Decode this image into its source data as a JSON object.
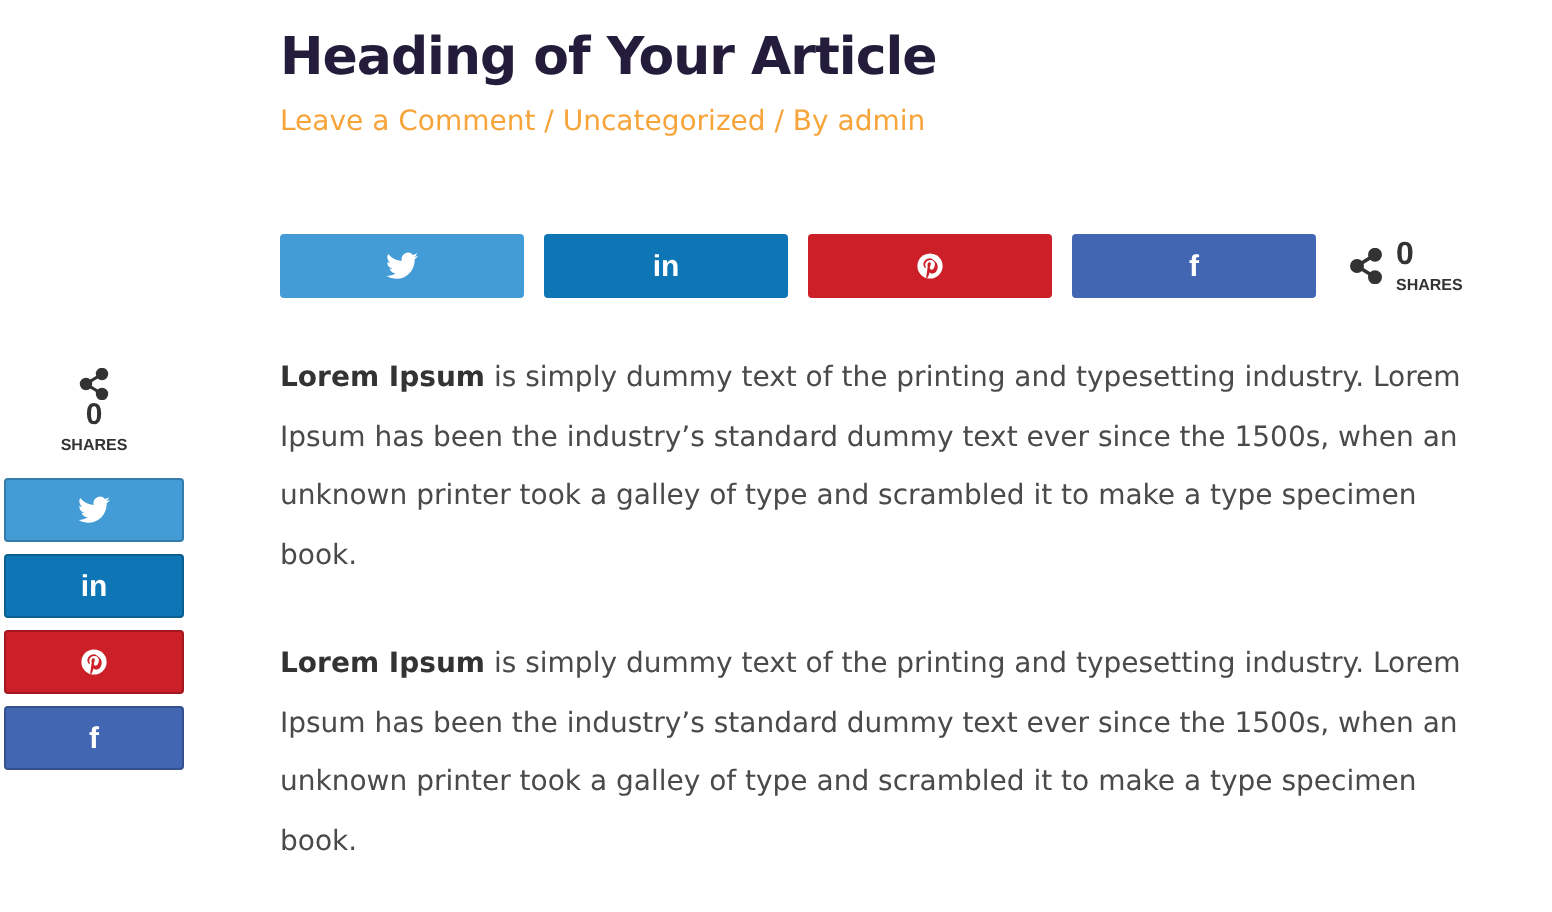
{
  "article": {
    "title": "Heading of Your Article",
    "meta": [
      {
        "text": "Leave a Comment"
      },
      {
        "text": " / "
      },
      {
        "text": "Uncategorized"
      },
      {
        "text": " / By "
      },
      {
        "text": "admin"
      }
    ]
  },
  "share_bar": {
    "buttons": [
      {
        "kind": "twitter",
        "color": "#439cd6"
      },
      {
        "kind": "linkedin",
        "label": "in",
        "color": "#0e76b5"
      },
      {
        "kind": "pinterest",
        "color": "#cc1f28"
      },
      {
        "kind": "facebook",
        "label": "f",
        "color": "#4266b2"
      }
    ],
    "count": "0",
    "count_label": "SHARES"
  },
  "sidebar": {
    "count": "0",
    "count_label": "SHARES",
    "buttons": [
      {
        "kind": "twitter",
        "color": "#439cd6"
      },
      {
        "kind": "linkedin",
        "label": "in",
        "color": "#0e76b5"
      },
      {
        "kind": "pinterest",
        "color": "#cc1f28"
      },
      {
        "kind": "facebook",
        "label": "f",
        "color": "#4266b2"
      }
    ]
  },
  "paragraphs": [
    "**Lorem Ipsum** is simply dummy text of the printing and typesetting industry. Lorem Ipsum has been the industry’s standard dummy text ever since the 1500s, when an unknown printer took a galley of type and scrambled it to make a type specimen book.",
    "**Lorem Ipsum** is simply dummy text of the printing and typesetting industry. Lorem Ipsum has been the industry’s standard dummy text ever since the 1500s, when an unknown printer took a galley of type and scrambled it to make a type specimen book."
  ]
}
